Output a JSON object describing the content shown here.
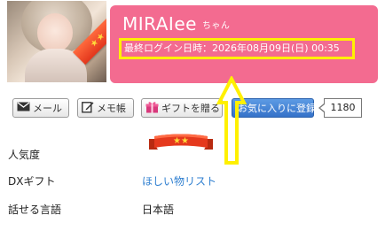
{
  "profile": {
    "name": "MIRAIee",
    "name_suffix": "ちゃん",
    "last_login": "最終ログイン日時：2026年08月09日(日) 00:35",
    "rank_stars": 2
  },
  "buttons": {
    "mail": "メール",
    "memo": "メモ帳",
    "gift": "ギフトを贈る",
    "favorite": "お気に入りに登録",
    "favorite_count": "1180"
  },
  "info": {
    "popularity_label": "人気度",
    "dx_gift_label": "DXギフト",
    "dx_gift_value": "ほしい物リスト",
    "language_label": "話せる言語",
    "language_value": "日本語"
  },
  "colors": {
    "name_bar": "#f36b90",
    "highlight": "#fff000",
    "favorite_button": "#3572c9",
    "link": "#2f7fd0",
    "ribbon": "#e2361c"
  },
  "icons": {
    "mail": "envelope-icon",
    "memo": "pencil-note-icon",
    "gift": "gift-box-icon",
    "annotation": "up-arrow-icon"
  }
}
